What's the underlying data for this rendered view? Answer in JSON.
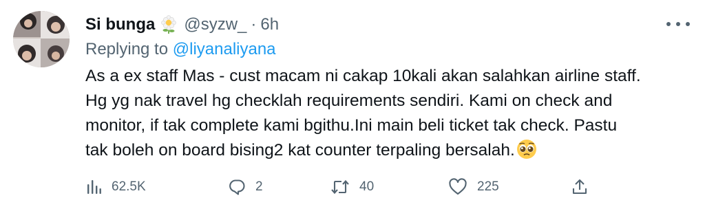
{
  "tweet": {
    "author": {
      "display_name": "Si bunga",
      "name_emoji": "flower-emoji",
      "handle": "@syzw_",
      "separator": "·",
      "time": "6h"
    },
    "reply": {
      "prefix": "Replying to ",
      "mention": "@liyanaliyana"
    },
    "body_lines": [
      "As a ex staff Mas - cust macam ni cakap 10kali akan salahkan airline staff.",
      "Hg yg nak travel hg checklah requirements sendiri. Kami on check and",
      "monitor, if tak complete kami bgithu.Ini main beli ticket tak check. Pastu",
      "tak boleh on board bising2 kat counter terpaling bersalah."
    ],
    "body_emoji": "pleading-face-emoji",
    "metrics": {
      "views": "62.5K",
      "replies": "2",
      "retweets": "40",
      "likes": "225"
    },
    "icons": {
      "views": "analytics-icon",
      "replies": "reply-icon",
      "retweets": "retweet-icon",
      "likes": "heart-icon",
      "share": "share-icon",
      "more": "more-icon"
    }
  }
}
